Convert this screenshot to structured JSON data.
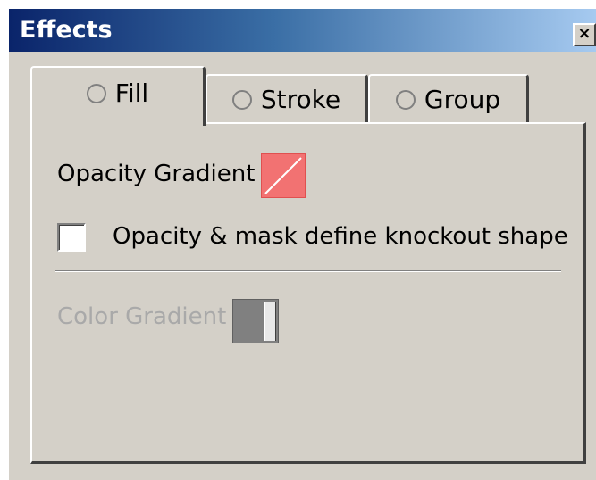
{
  "window": {
    "title": "Effects",
    "close_glyph": "×"
  },
  "tabs": [
    {
      "label": "Fill",
      "selected": true
    },
    {
      "label": "Stroke",
      "selected": false
    },
    {
      "label": "Group",
      "selected": false
    }
  ],
  "fill_panel": {
    "opacity_gradient_label": "Opacity Gradient",
    "opacity_gradient_swatch_color": "#f27272",
    "knockout_checkbox_label": "Opacity & mask define knockout shape",
    "knockout_checked": false,
    "color_gradient_label": "Color Gradient",
    "color_gradient_enabled": false,
    "color_gradient_swatch_color": "#808080"
  }
}
